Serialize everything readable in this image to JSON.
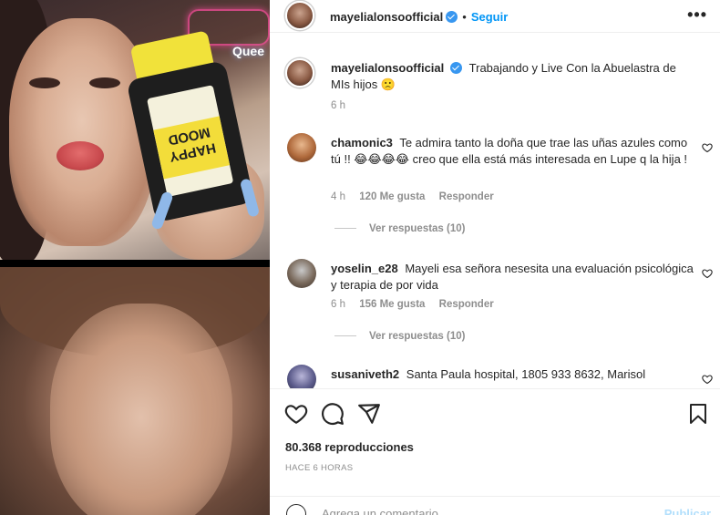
{
  "header": {
    "username": "mayelialonsoofficial",
    "follow_label": "Seguir",
    "separator": "•",
    "more_label": "•••"
  },
  "caption": {
    "username": "mayelialonsoofficial",
    "text": "Trabajando y Live Con la Abuelastra de MIs hijos 🙁",
    "time": "6 h"
  },
  "media": {
    "bottle_label": "HAPPY MOOD",
    "neon_text": "Quee"
  },
  "comments": [
    {
      "username": "chamonic3",
      "text": "Te admira tanto la doña que trae las uñas azules como tú !! 😂😂😂😂 creo que ella está más interesada en Lupe q la hija !",
      "time": "4 h",
      "likes": "120 Me gusta",
      "reply_label": "Responder",
      "view_replies": "Ver respuestas (10)"
    },
    {
      "username": "yoselin_e28",
      "text": "Mayeli esa señora nesesita una evaluación psicológica y terapia de por vida",
      "time": "6 h",
      "likes": "156 Me gusta",
      "reply_label": "Responder",
      "view_replies": "Ver respuestas (10)"
    },
    {
      "username": "susaniveth2",
      "text": "Santa Paula hospital, 1805 933 8632, Marisol"
    }
  ],
  "stats": {
    "views": "80.368 reproducciones",
    "posted_ago": "HACE 6 HORAS"
  },
  "composer": {
    "placeholder": "Agrega un comentario...",
    "publish_label": "Publicar"
  },
  "icons": {
    "like": "heart-icon",
    "comment": "comment-icon",
    "share": "share-icon",
    "save": "bookmark-icon",
    "emoji": "emoji-icon",
    "verified": "verified-badge-icon",
    "more": "more-options-icon"
  },
  "colors": {
    "accent": "#0095f6",
    "verified": "#3897f0",
    "muted": "#8e8e8e",
    "publish_disabled": "#b2dffc"
  }
}
